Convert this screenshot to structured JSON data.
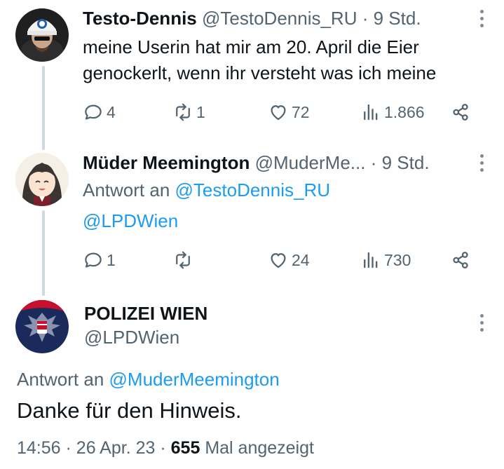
{
  "tweets": [
    {
      "name": "Testo-Dennis",
      "handle": "@TestoDennis_RU",
      "time": "9 Std.",
      "text_line1": "meine Userin hat mir am 20. April die Eier",
      "text_line2": "genockerlt, wenn ihr versteht was ich meine",
      "replies": "4",
      "retweets": "1",
      "likes": "72",
      "views": "1.866"
    },
    {
      "name": "Müder Meemington",
      "handle": "@MuderMe...",
      "time": "9 Std.",
      "reply_prefix": "Antwort an",
      "reply_to": "@TestoDennis_RU",
      "text_mention": "@LPDWien",
      "replies": "1",
      "retweets": "",
      "likes": "24",
      "views": "730"
    }
  ],
  "main_tweet": {
    "name": "POLIZEI WIEN",
    "handle": "@LPDWien",
    "reply_prefix": "Antwort an",
    "reply_to": "@MuderMeemington",
    "text": "Danke für den Hinweis.",
    "time": "14:56",
    "date": "26 Apr. 23",
    "views_count": "655",
    "views_label": "Mal angezeigt"
  },
  "separator": "·",
  "icons": {
    "reply": "reply-icon",
    "retweet": "retweet-icon",
    "like": "heart-icon",
    "views": "views-icon",
    "share": "share-icon",
    "more": "more-icon"
  },
  "colors": {
    "link": "#1d9bf0",
    "muted": "#536471",
    "text": "#0f1419",
    "thread_line": "#cfd9de"
  }
}
